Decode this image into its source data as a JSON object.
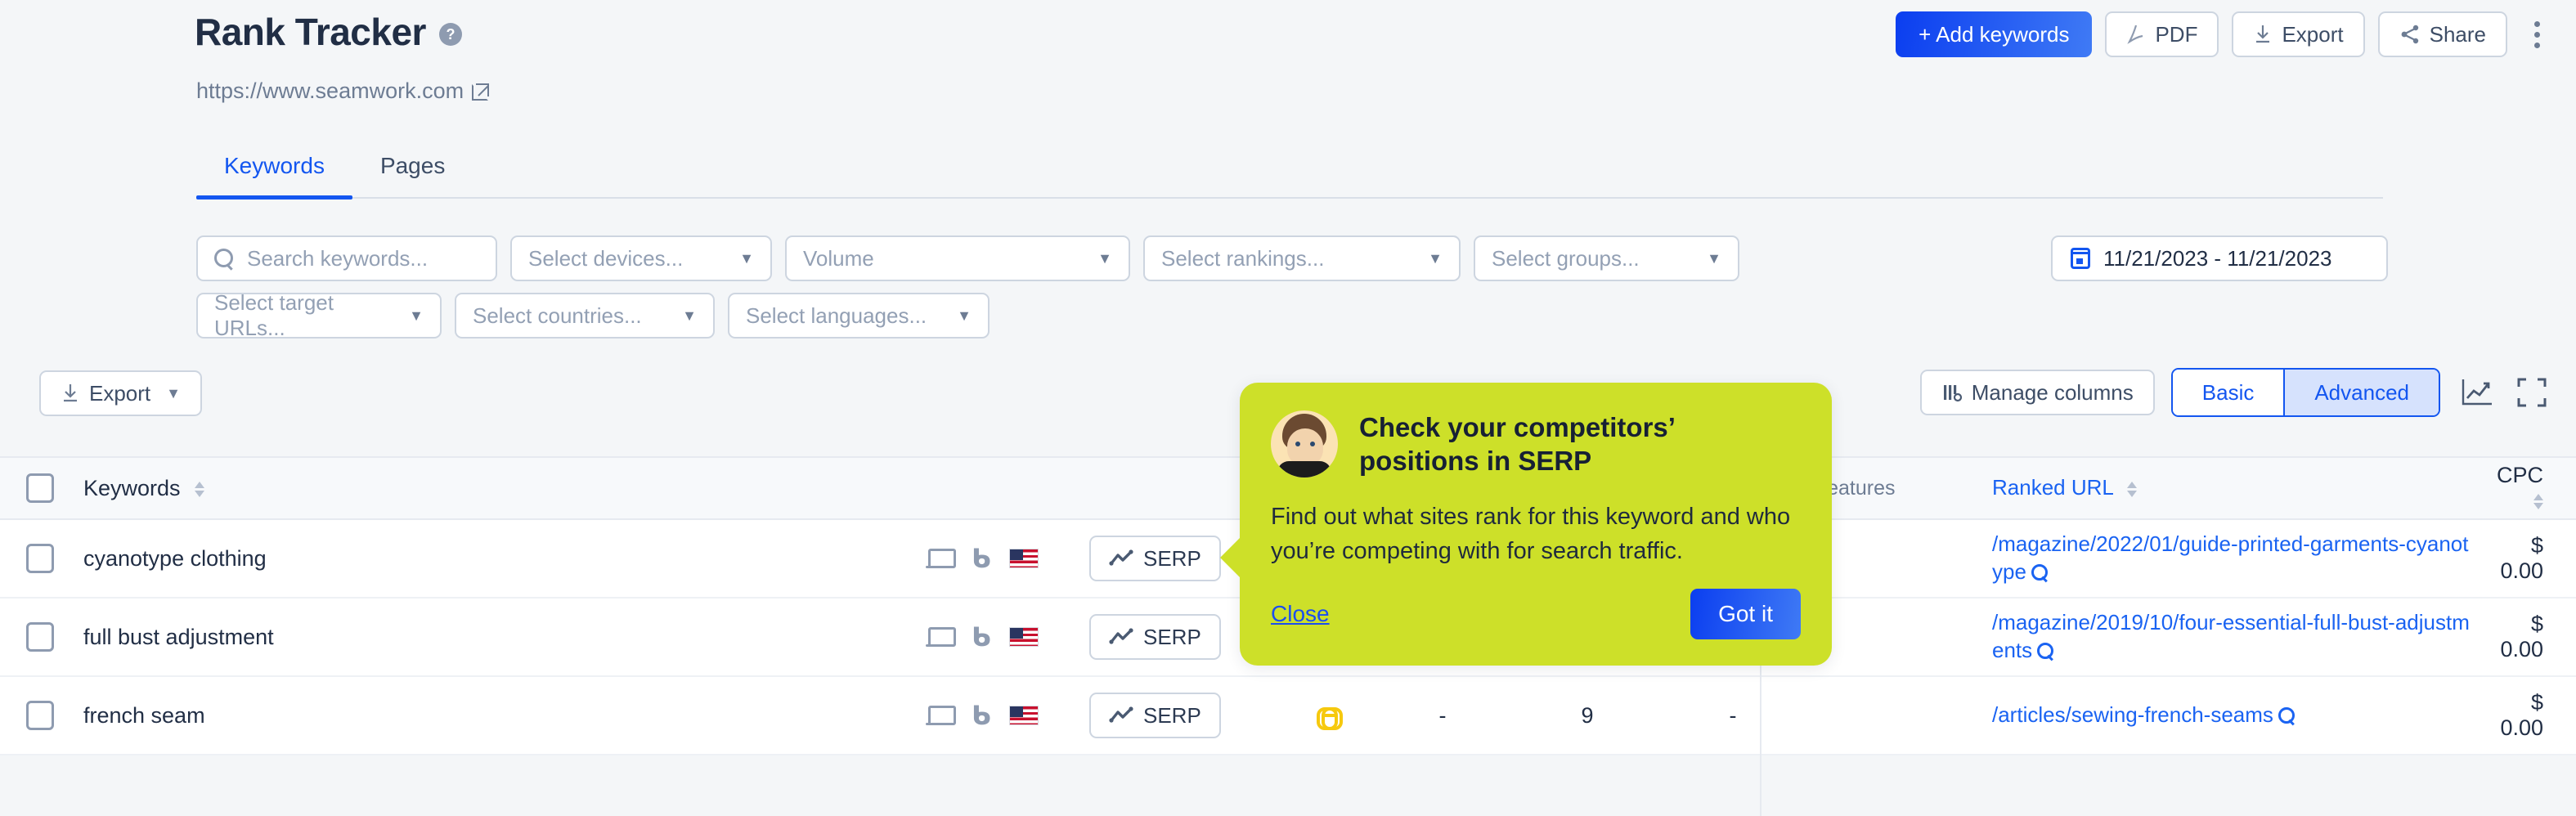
{
  "header": {
    "title": "Rank Tracker",
    "help_icon": "question-mark-icon",
    "site_url": "https://www.seamwork.com",
    "actions": {
      "add_keywords": "+  Add keywords",
      "pdf": "PDF",
      "export": "Export",
      "share": "Share",
      "more": "kebab-menu-icon"
    }
  },
  "tabs": [
    {
      "label": "Keywords",
      "active": true
    },
    {
      "label": "Pages",
      "active": false
    }
  ],
  "filters": {
    "search_placeholder": "Search keywords...",
    "search_value": "",
    "devices": "Select devices...",
    "volume": "Volume",
    "rankings": "Select rankings...",
    "groups": "Select groups...",
    "target_urls": "Select target URLs...",
    "countries": "Select countries...",
    "languages": "Select languages...",
    "date_range": "11/21/2023 - 11/21/2023"
  },
  "toolbar": {
    "export": "Export",
    "manage_columns": "Manage columns",
    "view_basic": "Basic",
    "view_advanced": "Advanced",
    "active_view": "Advanced",
    "chart_icon": "line-chart-icon",
    "fullscreen_icon": "fullscreen-icon"
  },
  "table": {
    "columns": {
      "keywords": "Keywords",
      "serp_features": "P features",
      "ranked_url": "Ranked URL",
      "cpc": "CPC"
    },
    "serp_button_label": "SERP",
    "rows": [
      {
        "keyword": "cyanotype clothing",
        "device": "desktop-icon",
        "engine": "bing-icon",
        "country": "us-flag-icon",
        "serp": "SERP",
        "link": "",
        "col_a": "",
        "col_b": "",
        "col_c": "",
        "ranked_url": "/magazine/2022/01/guide-printed-garments-cyanotype",
        "cpc": "$ 0.00"
      },
      {
        "keyword": "full bust adjustment",
        "device": "desktop-icon",
        "engine": "bing-icon",
        "country": "us-flag-icon",
        "serp": "SERP",
        "link": "",
        "col_a": "",
        "col_b": "",
        "col_c": "",
        "ranked_url": "/magazine/2019/10/four-essential-full-bust-adjustments",
        "cpc": "$ 0.00"
      },
      {
        "keyword": "french seam",
        "device": "desktop-icon",
        "engine": "bing-icon",
        "country": "us-flag-icon",
        "serp": "SERP",
        "link": "link-icon",
        "col_a": "-",
        "col_b": "9",
        "col_c": "-",
        "ranked_url": "/articles/sewing-french-seams",
        "cpc": "$ 0.00"
      }
    ]
  },
  "tooltip": {
    "title": "Check your competitors’ positions in SERP",
    "body": "Find out what sites rank for this keyword and who you’re competing with for search traffic.",
    "close": "Close",
    "confirm": "Got it",
    "avatar": "person-avatar"
  },
  "colors": {
    "accent_blue": "#1356f0",
    "tooltip_green": "#cde029",
    "text_dark": "#212e45",
    "muted": "#6d7c93",
    "link_yellow": "#f6c90e"
  }
}
